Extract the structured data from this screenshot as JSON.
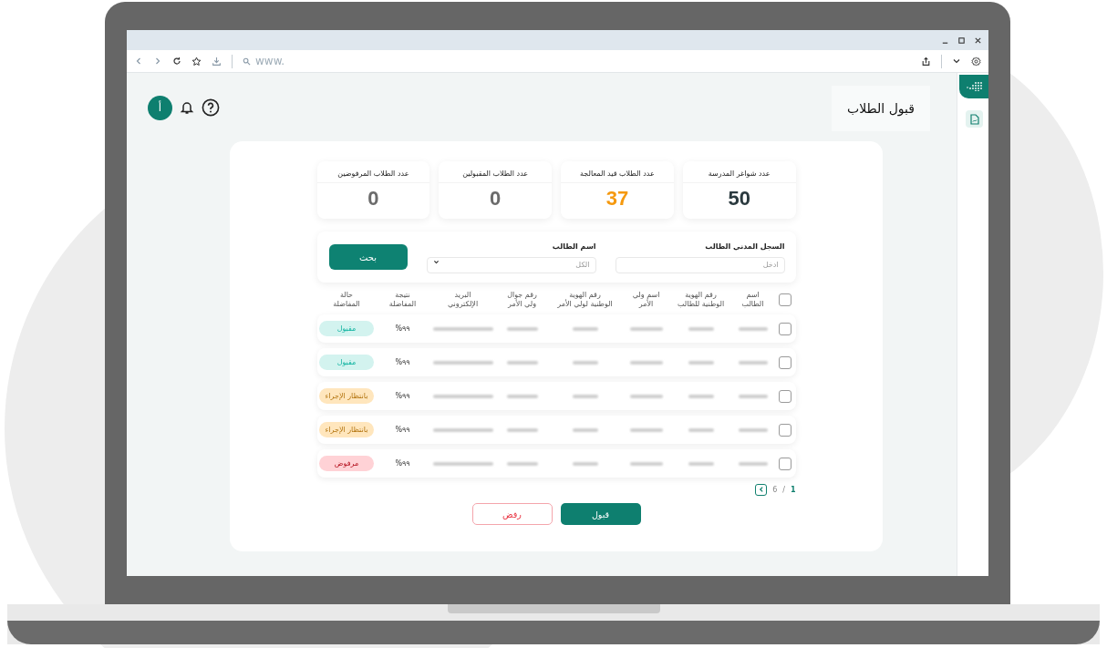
{
  "browser": {
    "address_placeholder": "www."
  },
  "header": {
    "title": "قبول الطلاب",
    "avatar_letter": "أ"
  },
  "stats": [
    {
      "label": "عدد شواغر المدرسة",
      "value": "50",
      "color": "#2b3a3f"
    },
    {
      "label": "عدد الطلاب قيد المعالجة",
      "value": "37",
      "color": "#f5990f"
    },
    {
      "label": "عدد الطلاب المقبولين",
      "value": "0",
      "color": "#6b6b6b"
    },
    {
      "label": "عدد الطلاب المرفوضين",
      "value": "0",
      "color": "#6b6b6b"
    }
  ],
  "filters": [
    {
      "label": "السجل المدني الطالب",
      "placeholder": "ادخل",
      "kind": "text"
    },
    {
      "label": "اسم الطالب",
      "placeholder": "الكل",
      "kind": "select"
    }
  ],
  "search_button": "بحث",
  "table": {
    "header_checked": false,
    "columns": [
      "اسم\nالطالب",
      "رقم الهوية\nالوطنية للطالب",
      "اسم ولي\nالأمر",
      "رقم الهوية\nالوطنية لولي الأمر",
      "رقم جوال\nولي الأمر",
      "البريد\nالإلكتروني",
      "نتيجة\nالمفاضلة",
      "حالة\nالمفاضلة"
    ],
    "rows": [
      {
        "checked": false,
        "result": "٩٩%",
        "status": "مقبول",
        "color": "#d3f3ef"
      },
      {
        "checked": false,
        "result": "٩٩%",
        "status": "مقبول",
        "color": "#d3f3ef"
      },
      {
        "checked": false,
        "result": "٩٩%",
        "status": "بانتظار الإجراء",
        "color": "#ffe6bd"
      },
      {
        "checked": false,
        "result": "٩٩%",
        "status": "بانتظار الإجراء",
        "color": "#ffe6bd"
      },
      {
        "checked": false,
        "result": "٩٩%",
        "status": "مرفوض",
        "color": "#ffd2d6"
      }
    ]
  },
  "pagination": {
    "current": "1",
    "separator": "/",
    "total": "6"
  },
  "actions": [
    {
      "label": "قبول",
      "kind": "primary"
    },
    {
      "label": "رفض",
      "kind": "danger"
    }
  ]
}
